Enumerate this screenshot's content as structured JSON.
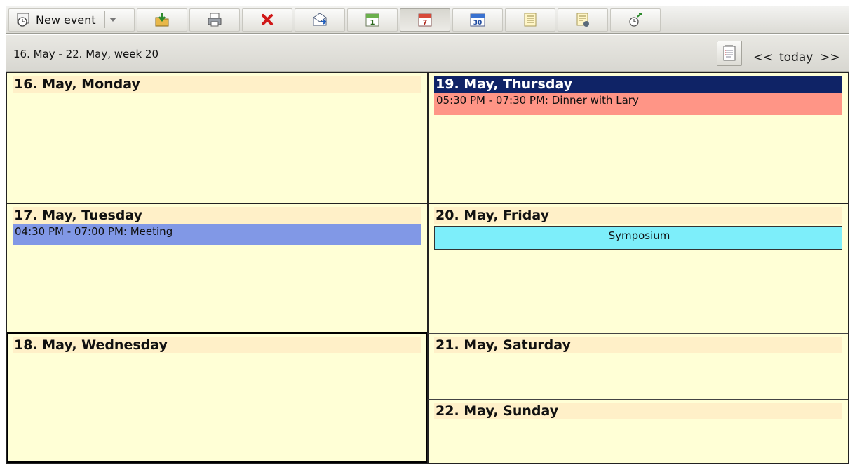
{
  "toolbar": {
    "new_event_label": "New event",
    "buttons": [
      {
        "icon": "import-icon"
      },
      {
        "icon": "print-icon"
      },
      {
        "icon": "delete-icon"
      },
      {
        "icon": "email-icon"
      },
      {
        "icon": "day-view-icon",
        "text": "1"
      },
      {
        "icon": "week-view-icon",
        "text": "7"
      },
      {
        "icon": "month-view-icon",
        "text": "30"
      },
      {
        "icon": "list-icon"
      },
      {
        "icon": "task-list-icon"
      },
      {
        "icon": "reminder-icon"
      }
    ]
  },
  "header": {
    "range": "16. May - 22. May, week 20",
    "prev": "<<",
    "today": "today",
    "next": ">>"
  },
  "days": {
    "monday": {
      "title": "16. May, Monday"
    },
    "tuesday": {
      "title": "17. May, Tuesday",
      "event": {
        "text": "04:30 PM - 07:00 PM: Meeting",
        "color": "#8198e6"
      }
    },
    "wednesday": {
      "title": "18. May, Wednesday"
    },
    "thursday": {
      "title": "19. May, Thursday",
      "event": {
        "text": "05:30 PM - 07:30 PM: Dinner with Lary",
        "color": "#ff9586"
      }
    },
    "friday": {
      "title": "20. May, Friday",
      "event": {
        "text": "Symposium",
        "color": "#7deefa"
      }
    },
    "saturday": {
      "title": "21. May, Saturday"
    },
    "sunday": {
      "title": "22. May, Sunday"
    }
  },
  "colors": {
    "cell_bg": "#ffffd6",
    "day_header_bg": "#fff0c8",
    "today_header_bg": "#0f2366"
  }
}
